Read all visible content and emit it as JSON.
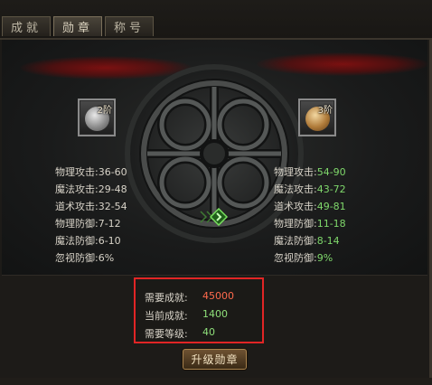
{
  "tabs": [
    {
      "label": "成就",
      "active": false
    },
    {
      "label": "勋章",
      "active": true
    },
    {
      "label": "称号",
      "active": false
    }
  ],
  "current_medal": {
    "tier_label": "2阶",
    "stats": [
      {
        "name": "物理攻击:",
        "value": "36-60"
      },
      {
        "name": "魔法攻击:",
        "value": "29-48"
      },
      {
        "name": "道术攻击:",
        "value": "32-54"
      },
      {
        "name": "物理防御:",
        "value": "7-12"
      },
      {
        "name": "魔法防御:",
        "value": "6-10"
      },
      {
        "name": "忽视防御:",
        "value": "6%"
      }
    ]
  },
  "next_medal": {
    "tier_label": "3阶",
    "stats": [
      {
        "name": "物理攻击:",
        "value": "54-90"
      },
      {
        "name": "魔法攻击:",
        "value": "43-72"
      },
      {
        "name": "道术攻击:",
        "value": "49-81"
      },
      {
        "name": "物理防御:",
        "value": "11-18"
      },
      {
        "name": "魔法防御:",
        "value": "8-14"
      },
      {
        "name": "忽视防御:",
        "value": "9%"
      }
    ]
  },
  "requirements": {
    "required_achievement_label": "需要成就:",
    "required_achievement_value": "45000",
    "current_achievement_label": "当前成就:",
    "current_achievement_value": "1400",
    "required_level_label": "需要等级:",
    "required_level_value": "40"
  },
  "upgrade_button_label": "升级勋章",
  "colors": {
    "stat_upgrade_green": "#7fd86b",
    "insufficient_red": "#ff6a4d",
    "highlight_border": "#e12525"
  },
  "icons": {
    "current_medal": "silver-medal-icon",
    "next_medal": "bronze-medal-icon",
    "upgrade_arrow": "green-arrow-icon"
  }
}
